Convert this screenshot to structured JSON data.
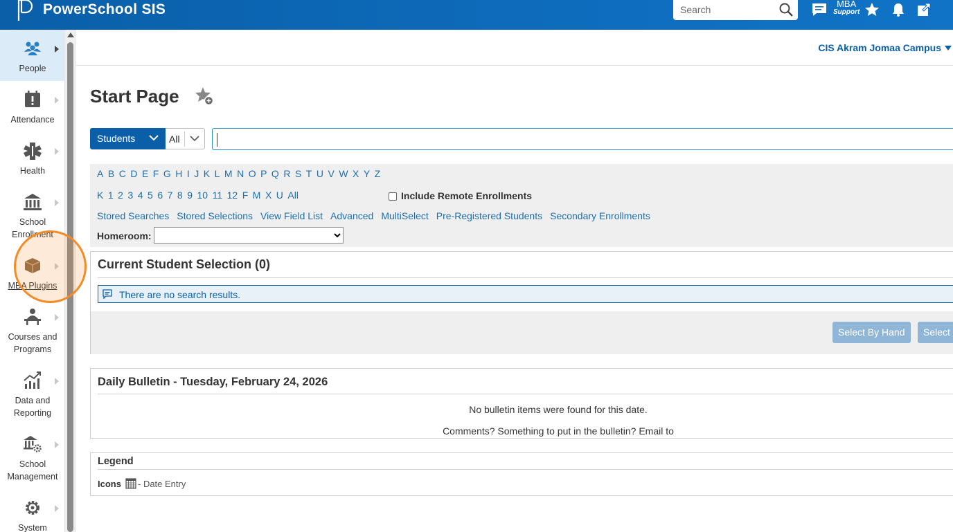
{
  "header": {
    "brand": "PowerSchool SIS",
    "search_placeholder": "Search",
    "mba_line1": "MBA",
    "mba_line2": "Support"
  },
  "sidebar": {
    "items": [
      {
        "label_lines": [
          "People"
        ],
        "icon": "people-icon"
      },
      {
        "label_lines": [
          "Attendance"
        ],
        "icon": "attendance-icon"
      },
      {
        "label_lines": [
          "Health"
        ],
        "icon": "health-icon"
      },
      {
        "label_lines": [
          "School",
          "Enrollment"
        ],
        "icon": "school-building-icon"
      },
      {
        "label_lines": [
          "MBA Plugins"
        ],
        "icon": "box-icon"
      },
      {
        "label_lines": [
          "Courses and",
          "Programs"
        ],
        "icon": "teacher-icon"
      },
      {
        "label_lines": [
          "Data and",
          "Reporting"
        ],
        "icon": "chart-icon"
      },
      {
        "label_lines": [
          "School",
          "Management"
        ],
        "icon": "school-gear-icon"
      },
      {
        "label_lines": [
          "System"
        ],
        "icon": "gear-icon"
      }
    ]
  },
  "campus": "CIS Akram Jomaa Campus",
  "page_title": "Start Page",
  "search": {
    "category": "Students",
    "scope": "All",
    "value": ""
  },
  "letters_row1": [
    "A",
    "B",
    "C",
    "D",
    "E",
    "F",
    "G",
    "H",
    "I",
    "J",
    "K",
    "L",
    "M",
    "N",
    "O",
    "P",
    "Q",
    "R",
    "S",
    "T",
    "U",
    "V",
    "W",
    "X",
    "Y",
    "Z"
  ],
  "letters_row2": [
    "K",
    "1",
    "2",
    "3",
    "4",
    "5",
    "6",
    "7",
    "8",
    "9",
    "10",
    "11",
    "12",
    "F",
    "M",
    "X",
    "U",
    "All"
  ],
  "include_remote": "Include Remote Enrollments",
  "links": [
    "Stored Searches",
    "Stored Selections",
    "View Field List",
    "Advanced",
    "MultiSelect",
    "Pre-Registered Students",
    "Secondary Enrollments"
  ],
  "homeroom_label": "Homeroom:",
  "selection": {
    "title": "Current Student Selection (0)",
    "message": "There are no search results.",
    "btn_hand": "Select By Hand",
    "btn_select": "Select"
  },
  "bulletin": {
    "title": "Daily Bulletin - Tuesday, February 24, 2026",
    "empty": "No bulletin items were found for this date.",
    "comments": "Comments? Something to put in the bulletin? Email to"
  },
  "legend": {
    "title": "Legend",
    "icons_label": "Icons",
    "date_entry": "- Date Entry"
  }
}
